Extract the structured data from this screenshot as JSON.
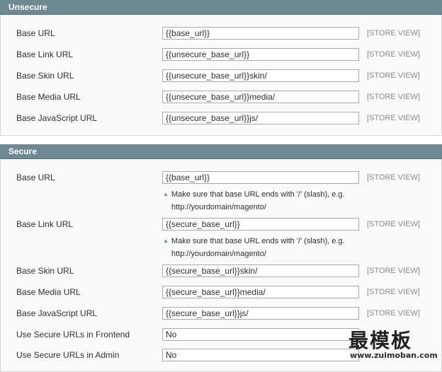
{
  "unsecure": {
    "title": "Unsecure",
    "rows": [
      {
        "label": "Base URL",
        "value": "{{base_url}}",
        "scope": "[STORE VIEW]"
      },
      {
        "label": "Base Link URL",
        "value": "{{unsecure_base_url}}",
        "scope": "[STORE VIEW]"
      },
      {
        "label": "Base Skin URL",
        "value": "{{unsecure_base_url}}skin/",
        "scope": "[STORE VIEW]"
      },
      {
        "label": "Base Media URL",
        "value": "{{unsecure_base_url}}media/",
        "scope": "[STORE VIEW]"
      },
      {
        "label": "Base JavaScript URL",
        "value": "{{unsecure_base_url}}js/",
        "scope": "[STORE VIEW]"
      }
    ]
  },
  "secure": {
    "title": "Secure",
    "note_line1": "Make sure that base URL ends with '/' (slash), e.g.",
    "note_line2": "http://yourdomain/magento/",
    "rows": [
      {
        "label": "Base URL",
        "value": "{{base_url}}",
        "scope": "[STORE VIEW]"
      },
      {
        "label": "Base Link URL",
        "value": "{{secure_base_url}}",
        "scope": "[STORE VIEW]"
      },
      {
        "label": "Base Skin URL",
        "value": "{{secure_base_url}}skin/",
        "scope": "[STORE VIEW]"
      },
      {
        "label": "Base Media URL",
        "value": "{{secure_base_url}}media/",
        "scope": "[STORE VIEW]"
      },
      {
        "label": "Base JavaScript URL",
        "value": "{{secure_base_url}}js/",
        "scope": "[STORE VIEW]"
      },
      {
        "label": "Use Secure URLs in Frontend",
        "value": "No"
      },
      {
        "label": "Use Secure URLs in Admin",
        "value": "No"
      }
    ]
  },
  "watermark": {
    "text": "最模板",
    "url": "www.zuimoban.com"
  }
}
